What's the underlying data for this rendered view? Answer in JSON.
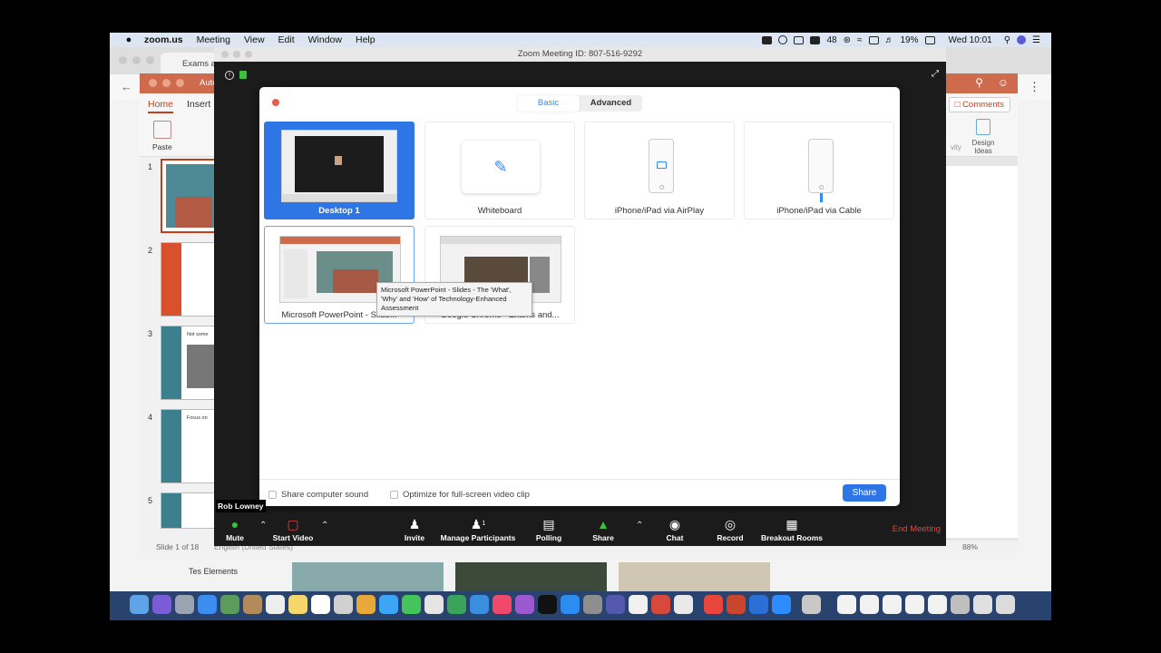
{
  "menubar": {
    "apple": "",
    "items": [
      "zoom.us",
      "Meeting",
      "View",
      "Edit",
      "Window",
      "Help"
    ],
    "battery_number": "48",
    "battery_percent": "19%",
    "clock": "Wed 10:01"
  },
  "browser": {
    "tab_title": "Exams a",
    "bottom_label": "Tes Elements"
  },
  "powerpoint": {
    "title_partial": "Auto",
    "ribbon_tabs": [
      "Home",
      "Insert"
    ],
    "comments_label": "Comments",
    "paste_label": "Paste",
    "design_ideas_label": "Design Ideas",
    "vity_fragment": "vity",
    "slide_numbers": [
      "1",
      "2",
      "3",
      "4",
      "5"
    ],
    "slide_texts": {
      "s3": "Not some",
      "s4": "Focus on"
    },
    "status_slide": "Slide 1 of 18",
    "status_lang": "English (United States)",
    "status_zoom": "88%"
  },
  "zoom": {
    "window_title": "Zoom Meeting ID: 807-516-9292",
    "participant_name": "Rob Lowney",
    "share_dialog": {
      "tabs": {
        "basic": "Basic",
        "advanced": "Advanced"
      },
      "options": [
        {
          "label": "Desktop 1",
          "selected": true
        },
        {
          "label": "Whiteboard"
        },
        {
          "label": "iPhone/iPad via AirPlay"
        },
        {
          "label": "iPhone/iPad via Cable"
        },
        {
          "label": "Microsoft PowerPoint - Slide..."
        },
        {
          "label": "Google Chrome - Exams and..."
        }
      ],
      "tooltip": "Microsoft PowerPoint - Slides - The 'What', 'Why' and 'How' of Technology-Enhanced Assessment",
      "share_sound": "Share computer sound",
      "optimize": "Optimize for full-screen video clip",
      "share_button": "Share"
    },
    "toolbar": {
      "mute": "Mute",
      "start_video": "Start Video",
      "invite": "Invite",
      "manage_participants": "Manage Participants",
      "participant_count": "1",
      "polling": "Polling",
      "share": "Share",
      "chat": "Chat",
      "record": "Record",
      "breakout_rooms": "Breakout Rooms",
      "end_meeting": "End Meeting"
    }
  },
  "colors": {
    "zoom_blue": "#2e76e6",
    "ppt_orange": "#cf6b4d",
    "end_red": "#e0453e",
    "share_green": "#3cbf3c"
  },
  "icons": {
    "menubar": [
      "apple-icon",
      "wifi-icon",
      "bluetooth-icon",
      "volume-icon",
      "search-icon",
      "siri-icon",
      "control-center-icon"
    ],
    "toolbar": [
      "microphone-icon",
      "video-off-icon",
      "invite-icon",
      "participants-icon",
      "polling-icon",
      "share-arrow-icon",
      "chat-icon",
      "record-icon",
      "breakout-rooms-icon"
    ]
  }
}
